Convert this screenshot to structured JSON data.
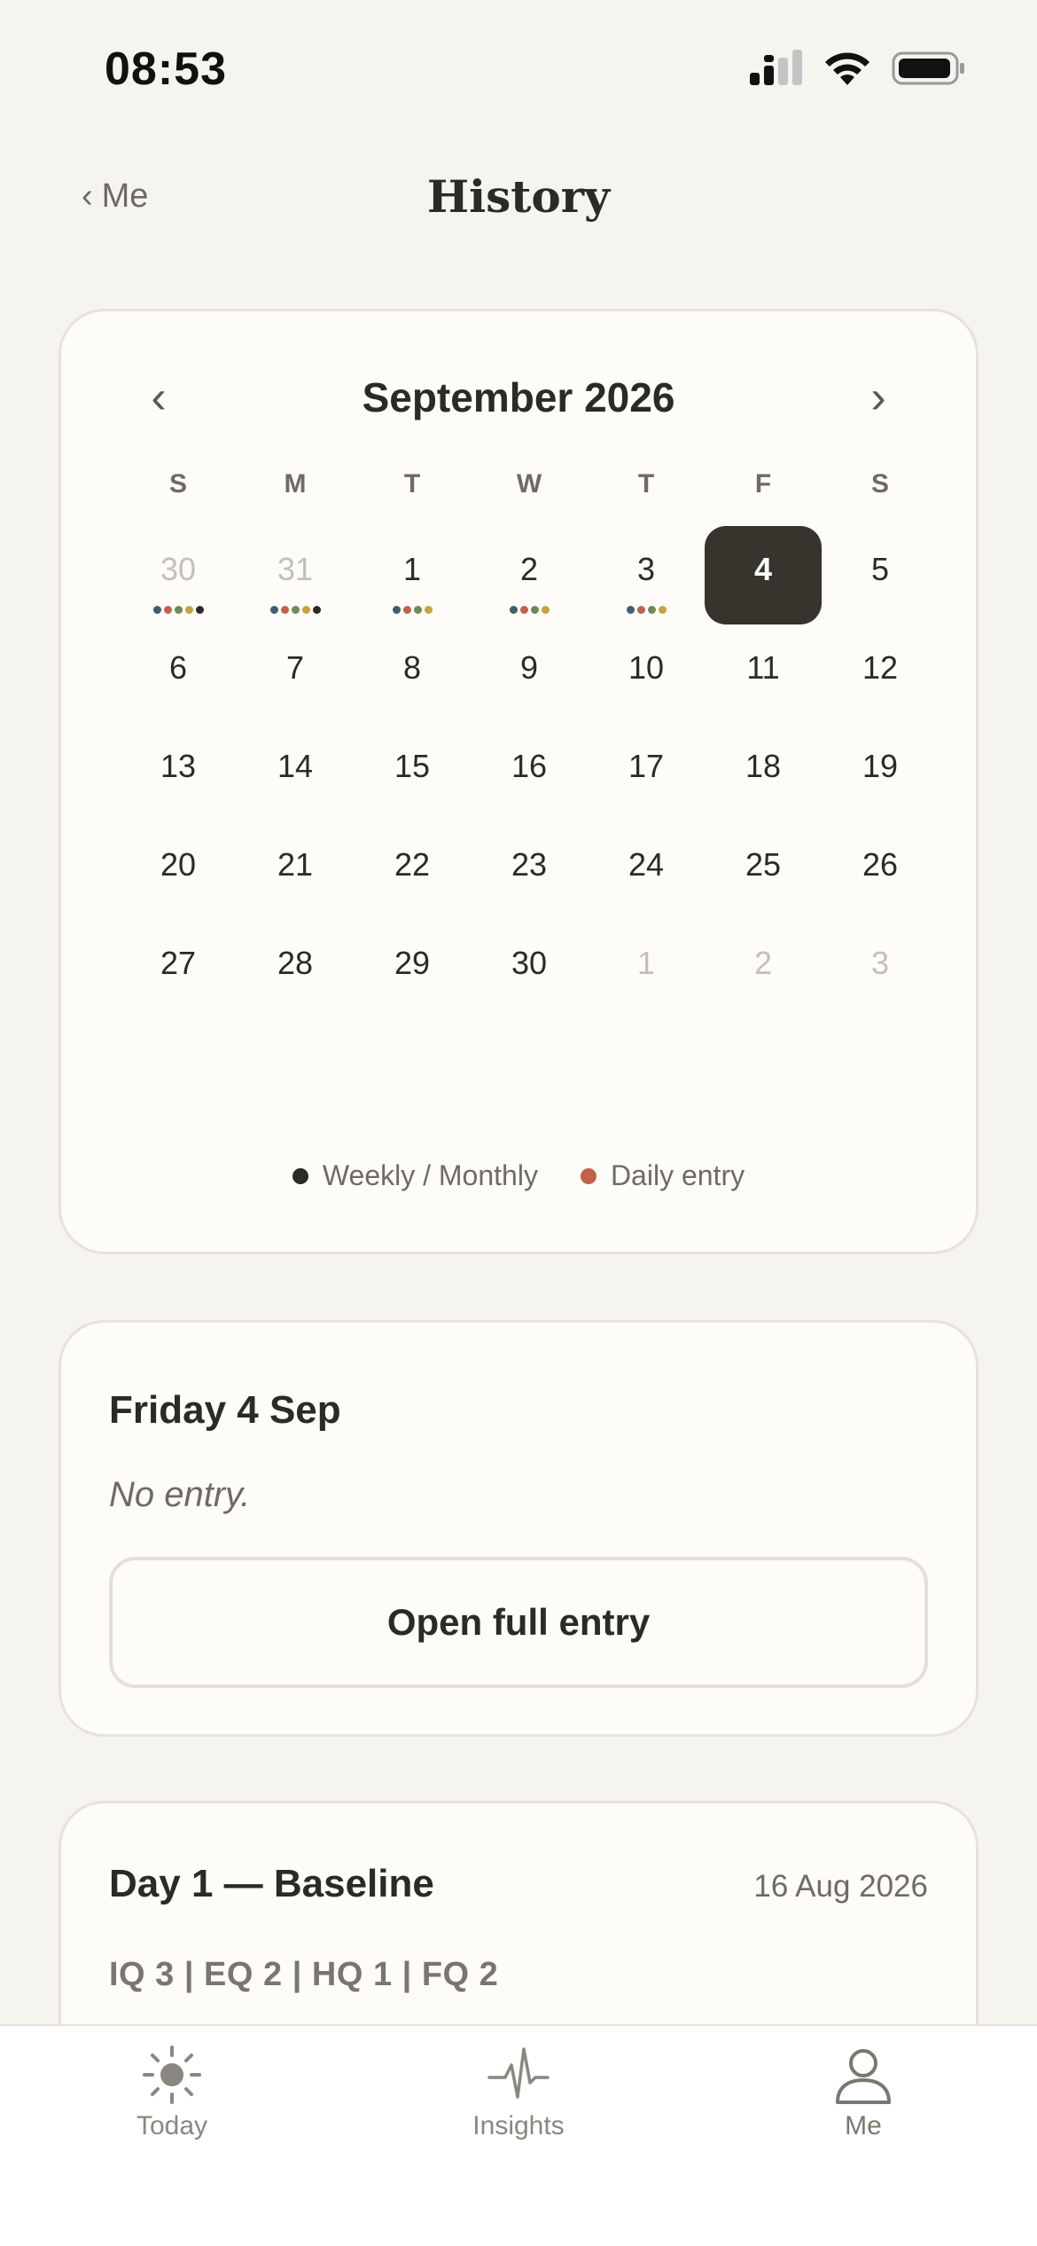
{
  "status": {
    "time": "08:53"
  },
  "nav": {
    "back_label": "Me",
    "title": "History"
  },
  "calendar": {
    "month_label": "September 2026",
    "weekdays": [
      "S",
      "M",
      "T",
      "W",
      "T",
      "F",
      "S"
    ],
    "days": [
      {
        "num": "30",
        "muted": true,
        "selected": false,
        "dots": [
          "#3f5e6e",
          "#c0634a",
          "#6c8a5a",
          "#c9a23c",
          "#2b2a27"
        ]
      },
      {
        "num": "31",
        "muted": true,
        "selected": false,
        "dots": [
          "#3f5e6e",
          "#c0634a",
          "#6c8a5a",
          "#c9a23c",
          "#2b2a27"
        ]
      },
      {
        "num": "1",
        "muted": false,
        "selected": false,
        "dots": [
          "#3f5e6e",
          "#c0634a",
          "#6c8a5a",
          "#c9a23c"
        ]
      },
      {
        "num": "2",
        "muted": false,
        "selected": false,
        "dots": [
          "#3f5e6e",
          "#c0634a",
          "#6c8a5a",
          "#c9a23c"
        ]
      },
      {
        "num": "3",
        "muted": false,
        "selected": false,
        "dots": [
          "#3f5e6e",
          "#c0634a",
          "#6c8a5a",
          "#c9a23c"
        ]
      },
      {
        "num": "4",
        "muted": false,
        "selected": true,
        "dots": []
      },
      {
        "num": "5",
        "muted": false,
        "selected": false,
        "dots": []
      },
      {
        "num": "6",
        "muted": false,
        "selected": false,
        "dots": []
      },
      {
        "num": "7",
        "muted": false,
        "selected": false,
        "dots": []
      },
      {
        "num": "8",
        "muted": false,
        "selected": false,
        "dots": []
      },
      {
        "num": "9",
        "muted": false,
        "selected": false,
        "dots": []
      },
      {
        "num": "10",
        "muted": false,
        "selected": false,
        "dots": []
      },
      {
        "num": "11",
        "muted": false,
        "selected": false,
        "dots": []
      },
      {
        "num": "12",
        "muted": false,
        "selected": false,
        "dots": []
      },
      {
        "num": "13",
        "muted": false,
        "selected": false,
        "dots": []
      },
      {
        "num": "14",
        "muted": false,
        "selected": false,
        "dots": []
      },
      {
        "num": "15",
        "muted": false,
        "selected": false,
        "dots": []
      },
      {
        "num": "16",
        "muted": false,
        "selected": false,
        "dots": []
      },
      {
        "num": "17",
        "muted": false,
        "selected": false,
        "dots": []
      },
      {
        "num": "18",
        "muted": false,
        "selected": false,
        "dots": []
      },
      {
        "num": "19",
        "muted": false,
        "selected": false,
        "dots": []
      },
      {
        "num": "20",
        "muted": false,
        "selected": false,
        "dots": []
      },
      {
        "num": "21",
        "muted": false,
        "selected": false,
        "dots": []
      },
      {
        "num": "22",
        "muted": false,
        "selected": false,
        "dots": []
      },
      {
        "num": "23",
        "muted": false,
        "selected": false,
        "dots": []
      },
      {
        "num": "24",
        "muted": false,
        "selected": false,
        "dots": []
      },
      {
        "num": "25",
        "muted": false,
        "selected": false,
        "dots": []
      },
      {
        "num": "26",
        "muted": false,
        "selected": false,
        "dots": []
      },
      {
        "num": "27",
        "muted": false,
        "selected": false,
        "dots": []
      },
      {
        "num": "28",
        "muted": false,
        "selected": false,
        "dots": []
      },
      {
        "num": "29",
        "muted": false,
        "selected": false,
        "dots": []
      },
      {
        "num": "30",
        "muted": false,
        "selected": false,
        "dots": []
      },
      {
        "num": "1",
        "muted": true,
        "selected": false,
        "dots": []
      },
      {
        "num": "2",
        "muted": true,
        "selected": false,
        "dots": []
      },
      {
        "num": "3",
        "muted": true,
        "selected": false,
        "dots": []
      }
    ],
    "legend": [
      {
        "label": "Weekly / Monthly",
        "color": "#2b2a27"
      },
      {
        "label": "Daily entry",
        "color": "#c0634a"
      }
    ]
  },
  "entry": {
    "title": "Friday 4 Sep",
    "empty_text": "No entry.",
    "open_button": "Open full entry"
  },
  "baseline": {
    "title": "Day 1 — Baseline",
    "date": "16 Aug 2026",
    "scores": "IQ 3 | EQ 2 | HQ 1 | FQ 2"
  },
  "tabs": [
    {
      "label": "Today",
      "icon": "sun-icon"
    },
    {
      "label": "Insights",
      "icon": "pulse-icon"
    },
    {
      "label": "Me",
      "icon": "person-icon"
    }
  ]
}
